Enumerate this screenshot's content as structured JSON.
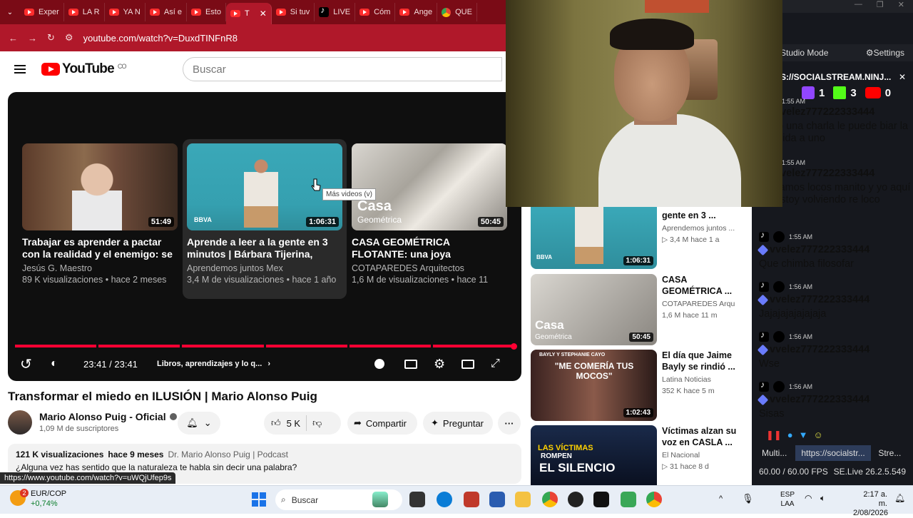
{
  "browser": {
    "tabs": [
      "Exper",
      "LA R",
      "YA N",
      "Así e",
      "Esto",
      "T",
      "Si tuv",
      "LIVE",
      "Cóm",
      "Ange",
      "QUE"
    ],
    "url": "youtube.com/watch?v=DuxdTINFnR8",
    "status_url": "https://www.youtube.com/watch?v=uWQjUfep9s"
  },
  "youtube": {
    "logo_text": "YouTube",
    "region": "CO",
    "search_placeholder": "Buscar"
  },
  "player": {
    "tooltip": "Más videos (v)",
    "time": "23:41 / 23:41",
    "chapter": "Libros, aprendizajes y lo q...",
    "progress": 1.0,
    "endcards": [
      {
        "title": "Trabajar es aprender a pactar con la realidad y el enemigo: se trabaj...",
        "channel": "Jesús G. Maestro",
        "meta": "89 K visualizaciones • hace 2 meses",
        "duration": "51:49"
      },
      {
        "title": "Aprende a leer a la gente en 3 minutos | Bárbara Tijerina, expert...",
        "channel": "Aprendemos juntos Mex",
        "meta": "3,4 M de visualizaciones • hace 1 año",
        "duration": "1:06:31"
      },
      {
        "title": "CASA GEOMÉTRICA FLOTANTE: una joya arquitectónica en CDMX ...",
        "channel": "COTAPAREDES Arquitectos",
        "meta": "1,6 M de visualizaciones • hace 11",
        "duration": "50:45"
      }
    ]
  },
  "video": {
    "title": "Transformar el miedo en ILUSIÓN | Mario Alonso Puig",
    "channel": "Mario Alonso Puig - Oficial",
    "subscribers": "1,09 M de suscriptores",
    "likes": "5 K",
    "share_label": "Compartir",
    "ask_label": "Preguntar",
    "views": "121 K visualizaciones",
    "age": "hace 9 meses",
    "tags": "Dr. Mario Alonso Puig | Podcast",
    "description": "¿Alguna vez has sentido que la naturaleza te habla sin decir una palabra?"
  },
  "sidebar": [
    {
      "title": "gente en 3 ...",
      "channel": "Aprendemos juntos ...",
      "views": "3,4 M",
      "age": "hace 1 a",
      "duration": "1:06:31"
    },
    {
      "title": "CASA GEOMÉTRICA ...",
      "channel": "COTAPAREDES Arqu",
      "views": "1,6 M",
      "age": "hace 11 m",
      "duration": "50:45"
    },
    {
      "title": "El día que Jaime Bayly se rindió ...",
      "channel": "Latina Noticias",
      "views": "352 K",
      "age": "hace 5 m",
      "duration": "1:02:43"
    },
    {
      "title": "Víctimas alzan su voz en CASLA ...",
      "channel": "El Nacional",
      "views": "31",
      "age": "hace 8 d",
      "duration": ""
    }
  ],
  "thumb_text": {
    "bbva": "BBVA",
    "casa": "Casa",
    "geometrica": "Geométrica",
    "bayly_top": "BAYLY Y STEPHANIE CAYO",
    "bayly_quote": "\"ME COMERÍA TUS MOCOS\"",
    "victimas_1": "LAS VÍCTIMAS",
    "victimas_2": "ROMPEN",
    "victimas_3": "EL SILENCIO"
  },
  "stream_panel": {
    "studio_mode": "Studio Mode",
    "settings": "Settings",
    "source_url": "S://SOCIALSTREAM.NINJ...",
    "counts": {
      "twitch": "1",
      "kick": "3",
      "youtube": "0"
    },
    "messages": [
      {
        "time": "1:55 AM",
        "user": "vvelez777222333444",
        "text": "o una charla le puede biar la vida a uno"
      },
      {
        "time": "1:55 AM",
        "user": "vvelez777222333444",
        "text": "s estamos locos manito y yo aquí me estoy volviendo re loco"
      },
      {
        "time": "1:55 AM",
        "user": "vvelez777222333444",
        "text": "Que chimba filosofar"
      },
      {
        "time": "1:56 AM",
        "user": "vvelez777222333444",
        "text": "Jajajajajajajaja"
      },
      {
        "time": "1:56 AM",
        "user": "vvelez777222333444",
        "text": "Wse"
      },
      {
        "time": "1:56 AM",
        "user": "vvelez777222333444",
        "text": "Sisas"
      }
    ],
    "bottom_tabs": [
      "Multi...",
      "https://socialstr...",
      "Stre..."
    ],
    "fps": "60.00 / 60.00 FPS",
    "version": "SE.Live 26.2.5.549"
  },
  "taskbar": {
    "ticker_name": "EUR/COP",
    "ticker_change": "+0,74%",
    "badge": "2",
    "search": "Buscar",
    "lang": "ESP",
    "lang2": "LAA",
    "time": "2:17 a. m.",
    "date": "2/08/2026"
  }
}
